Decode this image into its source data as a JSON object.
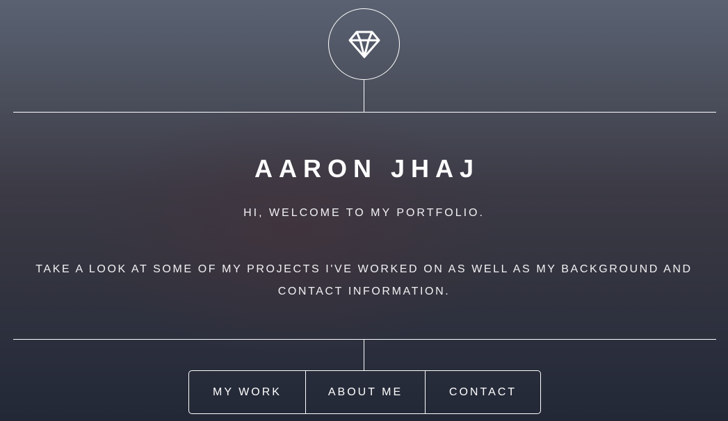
{
  "logo": {
    "icon": "diamond-icon",
    "color": "#ffffff"
  },
  "hero": {
    "name": "AARON JHAJ",
    "welcome": "HI, WELCOME TO MY PORTFOLIO.",
    "description": "TAKE A LOOK AT SOME OF MY PROJECTS I'VE WORKED ON AS WELL AS MY BACKGROUND AND CONTACT INFORMATION."
  },
  "nav": {
    "items": [
      {
        "label": "MY WORK"
      },
      {
        "label": "ABOUT ME"
      },
      {
        "label": "CONTACT"
      }
    ]
  },
  "colors": {
    "text": "#ffffff",
    "background_top": "#5a6272",
    "background_bottom": "#222836"
  }
}
